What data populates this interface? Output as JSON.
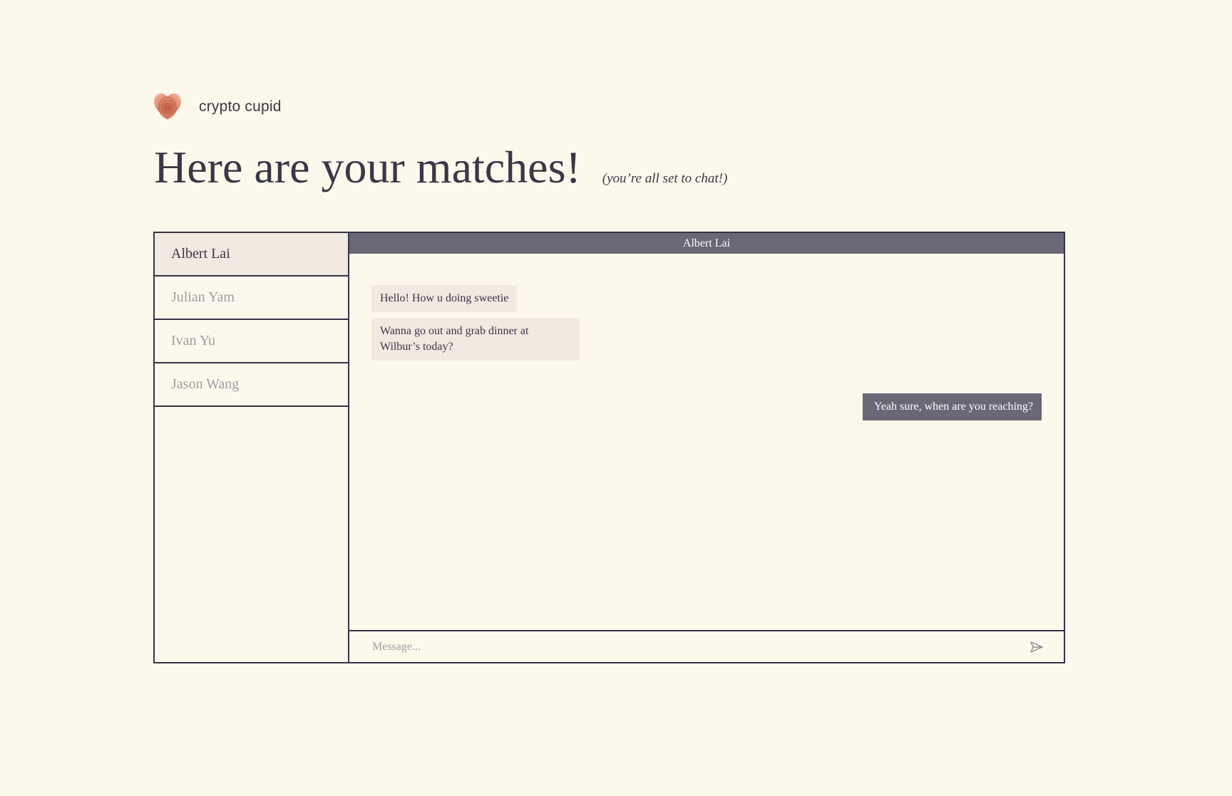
{
  "brand": {
    "name": "crypto cupid",
    "logo_icon": "fingerprint-heart-icon"
  },
  "header": {
    "title": "Here are your matches!",
    "subtitle": "(you’re all set to chat!)"
  },
  "matches": [
    {
      "name": "Albert Lai",
      "active": true
    },
    {
      "name": "Julian Yam",
      "active": false
    },
    {
      "name": "Ivan Yu",
      "active": false
    },
    {
      "name": "Jason Wang",
      "active": false
    }
  ],
  "conversation": {
    "contact_name": "Albert Lai",
    "messages": [
      {
        "direction": "received",
        "text": "Hello! How u doing sweetie"
      },
      {
        "direction": "received",
        "text": "Wanna go out and grab dinner at Wilbur’s today?"
      },
      {
        "direction": "sent",
        "text": "Yeah sure, when are you reaching?"
      }
    ]
  },
  "composer": {
    "placeholder": "Message...",
    "value": "",
    "send_icon": "send-icon"
  },
  "colors": {
    "background": "#fcf9ec",
    "text": "#3a3746",
    "border": "#35324a",
    "accent": "#6a6776",
    "highlight": "#f2e9e0",
    "muted": "#a09ca2",
    "brand": "#d9735a"
  }
}
